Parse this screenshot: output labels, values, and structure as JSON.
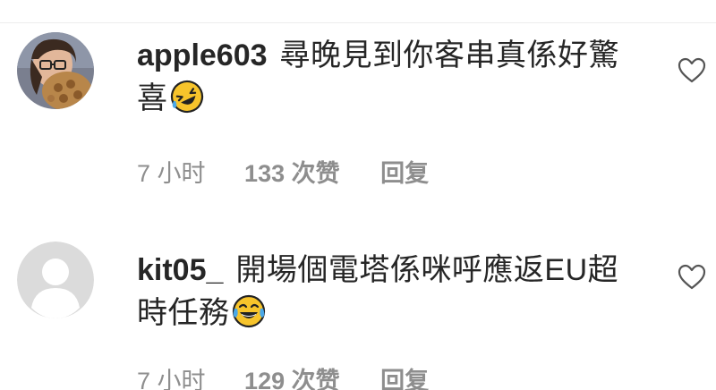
{
  "comments": [
    {
      "username": "apple603",
      "text": "尋晚見到你客串真係好驚喜",
      "emoji": "rolling-on-floor-laughing",
      "time": "7 小时",
      "likes": "133 次赞",
      "reply": "回复"
    },
    {
      "username": "kit05_",
      "text": "開場個電塔係咪呼應返EU超時任務",
      "emoji": "face-with-tears-of-joy",
      "time": "7 小时",
      "likes": "129 次赞",
      "reply": "回复"
    }
  ],
  "colors": {
    "text": "#262626",
    "meta": "#8e8e8e",
    "emoji_yellow": "#f7c42b",
    "emoji_tear": "#4aa8e8",
    "default_avatar_bg": "#dbdbdb"
  }
}
